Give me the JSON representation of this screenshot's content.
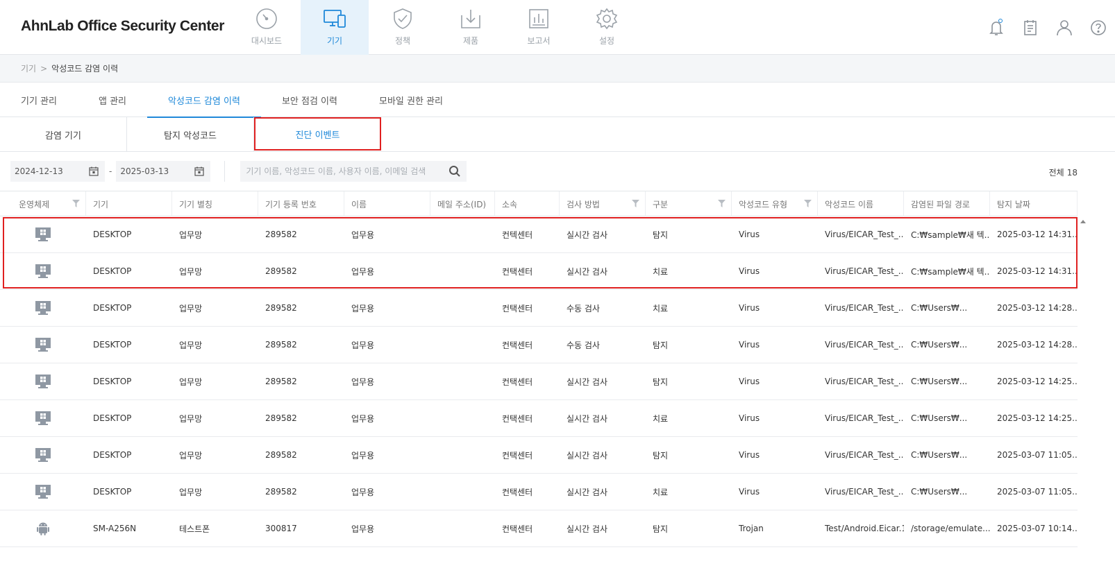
{
  "app": {
    "logo": "AhnLab Office Security Center"
  },
  "gnb": [
    {
      "label": "대시보드",
      "icon": "dashboard-icon",
      "active": false
    },
    {
      "label": "기기",
      "icon": "devices-icon",
      "active": true
    },
    {
      "label": "정책",
      "icon": "shield-check-icon",
      "active": false
    },
    {
      "label": "제품",
      "icon": "download-box-icon",
      "active": false
    },
    {
      "label": "보고서",
      "icon": "report-chart-icon",
      "active": false
    },
    {
      "label": "설정",
      "icon": "gear-icon",
      "active": false
    }
  ],
  "util": [
    "bell-icon",
    "notepad-icon",
    "user-icon",
    "help-icon"
  ],
  "breadcrumb": {
    "parent": "기기",
    "separator": ">",
    "current": "악성코드 감염 이력"
  },
  "tabs": [
    {
      "label": "기기 관리",
      "active": false
    },
    {
      "label": "앱 관리",
      "active": false
    },
    {
      "label": "악성코드 감염 이력",
      "active": true
    },
    {
      "label": "보안 점검 이력",
      "active": false
    },
    {
      "label": "모바일 권한 관리",
      "active": false
    }
  ],
  "subtabs": [
    {
      "label": "감염 기기",
      "active": false
    },
    {
      "label": "탐지 악성코드",
      "active": false
    },
    {
      "label": "진단 이벤트",
      "active": true
    }
  ],
  "filter": {
    "date_from": "2024-12-13",
    "date_sep": "-",
    "date_to": "2025-03-13",
    "search_placeholder": "기기 이름, 악성코드 이름, 사용자 이름, 이메일 검색",
    "total_label": "전체",
    "total_count": "18"
  },
  "columns": [
    {
      "label": "운영체제",
      "filter": true
    },
    {
      "label": "기기",
      "filter": false
    },
    {
      "label": "기기 별칭",
      "filter": false
    },
    {
      "label": "기기 등록 번호",
      "filter": false
    },
    {
      "label": "이름",
      "filter": false
    },
    {
      "label": "메일 주소(ID)",
      "filter": false
    },
    {
      "label": "소속",
      "filter": false
    },
    {
      "label": "검사 방법",
      "filter": true
    },
    {
      "label": "구분",
      "filter": true
    },
    {
      "label": "악성코드 유형",
      "filter": true
    },
    {
      "label": "악성코드 이름",
      "filter": false
    },
    {
      "label": "감염된 파일 경로",
      "filter": false
    },
    {
      "label": "탐지 날짜",
      "filter": false
    }
  ],
  "rows": [
    {
      "os": "windows-icon",
      "device": "DESKTOP",
      "alias": "업무망",
      "reg_no": "289582",
      "name": "업무용",
      "email": "",
      "org": "컨텍센터",
      "scan": "실시간 검사",
      "type": "탐지",
      "mal_type": "Virus",
      "mal_name": "Virus/EICAR_Test_...",
      "path": "C:₩sample₩새 텍...",
      "date": "2025-03-12 14:31..."
    },
    {
      "os": "windows-icon",
      "device": "DESKTOP",
      "alias": "업무망",
      "reg_no": "289582",
      "name": "업무용",
      "email": "",
      "org": "컨택센터",
      "scan": "실시간 검사",
      "type": "치료",
      "mal_type": "Virus",
      "mal_name": "Virus/EICAR_Test_...",
      "path": "C:₩sample₩새 텍...",
      "date": "2025-03-12 14:31..."
    },
    {
      "os": "windows-icon",
      "device": "DESKTOP",
      "alias": "업무망",
      "reg_no": "289582",
      "name": "업무용",
      "email": "",
      "org": "컨택센터",
      "scan": "수동 검사",
      "type": "치료",
      "mal_type": "Virus",
      "mal_name": "Virus/EICAR_Test_...",
      "path": "C:₩Users₩...",
      "date": "2025-03-12 14:28..."
    },
    {
      "os": "windows-icon",
      "device": "DESKTOP",
      "alias": "업무망",
      "reg_no": "289582",
      "name": "업무용",
      "email": "",
      "org": "컨택센터",
      "scan": "수동 검사",
      "type": "탐지",
      "mal_type": "Virus",
      "mal_name": "Virus/EICAR_Test_...",
      "path": "C:₩Users₩...",
      "date": "2025-03-12 14:28..."
    },
    {
      "os": "windows-icon",
      "device": "DESKTOP",
      "alias": "업무망",
      "reg_no": "289582",
      "name": "업무용",
      "email": "",
      "org": "컨택센터",
      "scan": "실시간 검사",
      "type": "탐지",
      "mal_type": "Virus",
      "mal_name": "Virus/EICAR_Test_...",
      "path": "C:₩Users₩...",
      "date": "2025-03-12 14:25..."
    },
    {
      "os": "windows-icon",
      "device": "DESKTOP",
      "alias": "업무망",
      "reg_no": "289582",
      "name": "업무용",
      "email": "",
      "org": "컨택센터",
      "scan": "실시간 검사",
      "type": "치료",
      "mal_type": "Virus",
      "mal_name": "Virus/EICAR_Test_...",
      "path": "C:₩Users₩...",
      "date": "2025-03-12 14:25..."
    },
    {
      "os": "windows-icon",
      "device": "DESKTOP",
      "alias": "업무망",
      "reg_no": "289582",
      "name": "업무용",
      "email": "",
      "org": "컨택센터",
      "scan": "실시간 검사",
      "type": "탐지",
      "mal_type": "Virus",
      "mal_name": "Virus/EICAR_Test_...",
      "path": "C:₩Users₩...",
      "date": "2025-03-07 11:05..."
    },
    {
      "os": "windows-icon",
      "device": "DESKTOP",
      "alias": "업무망",
      "reg_no": "289582",
      "name": "업무용",
      "email": "",
      "org": "컨택센터",
      "scan": "실시간 검사",
      "type": "치료",
      "mal_type": "Virus",
      "mal_name": "Virus/EICAR_Test_...",
      "path": "C:₩Users₩...",
      "date": "2025-03-07 11:05..."
    },
    {
      "os": "android-icon",
      "device": "SM-A256N",
      "alias": "테스트폰",
      "reg_no": "300817",
      "name": "업무용",
      "email": "",
      "org": "컨택센터",
      "scan": "실시간 검사",
      "type": "탐지",
      "mal_type": "Trojan",
      "mal_name": "Test/Android.Eicar.1",
      "path": "/storage/emulate...",
      "date": "2025-03-07 10:14..."
    }
  ],
  "colors": {
    "accent": "#1e88d9",
    "highlight": "#e02020"
  }
}
